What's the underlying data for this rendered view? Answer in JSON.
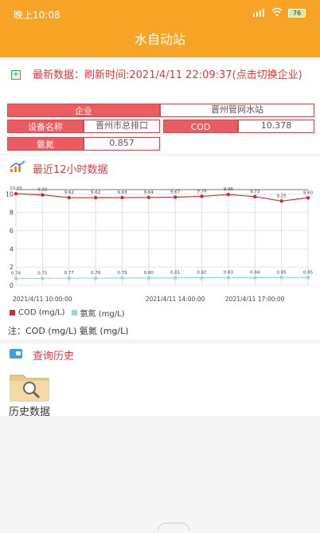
{
  "status_bar": {
    "time": "晚上10:08",
    "battery": "76"
  },
  "app": {
    "title": "水自动站"
  },
  "latest": {
    "text": "最新数据：刷新时间:2021/4/11 22:09:37(点击切换企业)",
    "fields": {
      "company_label": "企业",
      "company_value": "晋州管网水站",
      "device_label": "设备名称",
      "device_value": "晋州市总排口",
      "cod_label": "COD",
      "cod_value": "10.378",
      "nh3_label": "氨氮",
      "nh3_value": "0.857"
    }
  },
  "trend": {
    "title": "最近12小时数据",
    "note": "注：COD (mg/L)  氨氮 (mg/L)"
  },
  "colors": {
    "accent": "#f7a325",
    "red": "#e0383e",
    "cod": "#d42b2f",
    "nh3": "#8fd6f0"
  },
  "chart_data": {
    "type": "line",
    "x": [
      "2021/4/11 10:00:00",
      "",
      "",
      "",
      "",
      "2021/4/11 14:00:00",
      "",
      "",
      "2021/4/11 17:00:00",
      "",
      "",
      ""
    ],
    "x_ticks": [
      "2021/4/11 10:00:00",
      "2021/4/11 14:00:00",
      "2021/4/11 17:00:00"
    ],
    "y_ticks": [
      "0",
      "2",
      "4",
      "6",
      "8",
      "10"
    ],
    "ylim": [
      0,
      10.5
    ],
    "series": [
      {
        "name": "COD (mg/L)",
        "color": "#d42b2f",
        "values": [
          10.05,
          9.92,
          9.62,
          9.62,
          9.63,
          9.64,
          9.67,
          9.76,
          9.96,
          9.73,
          9.25,
          9.6
        ]
      },
      {
        "name": "氨氮 (mg/L)",
        "color": "#8fd6f0",
        "values": [
          0.74,
          0.75,
          0.77,
          0.78,
          0.79,
          0.8,
          0.81,
          0.82,
          0.83,
          0.84,
          0.85,
          0.85
        ]
      }
    ]
  },
  "history": {
    "title": "查询历史",
    "item_label": "历史数据"
  }
}
